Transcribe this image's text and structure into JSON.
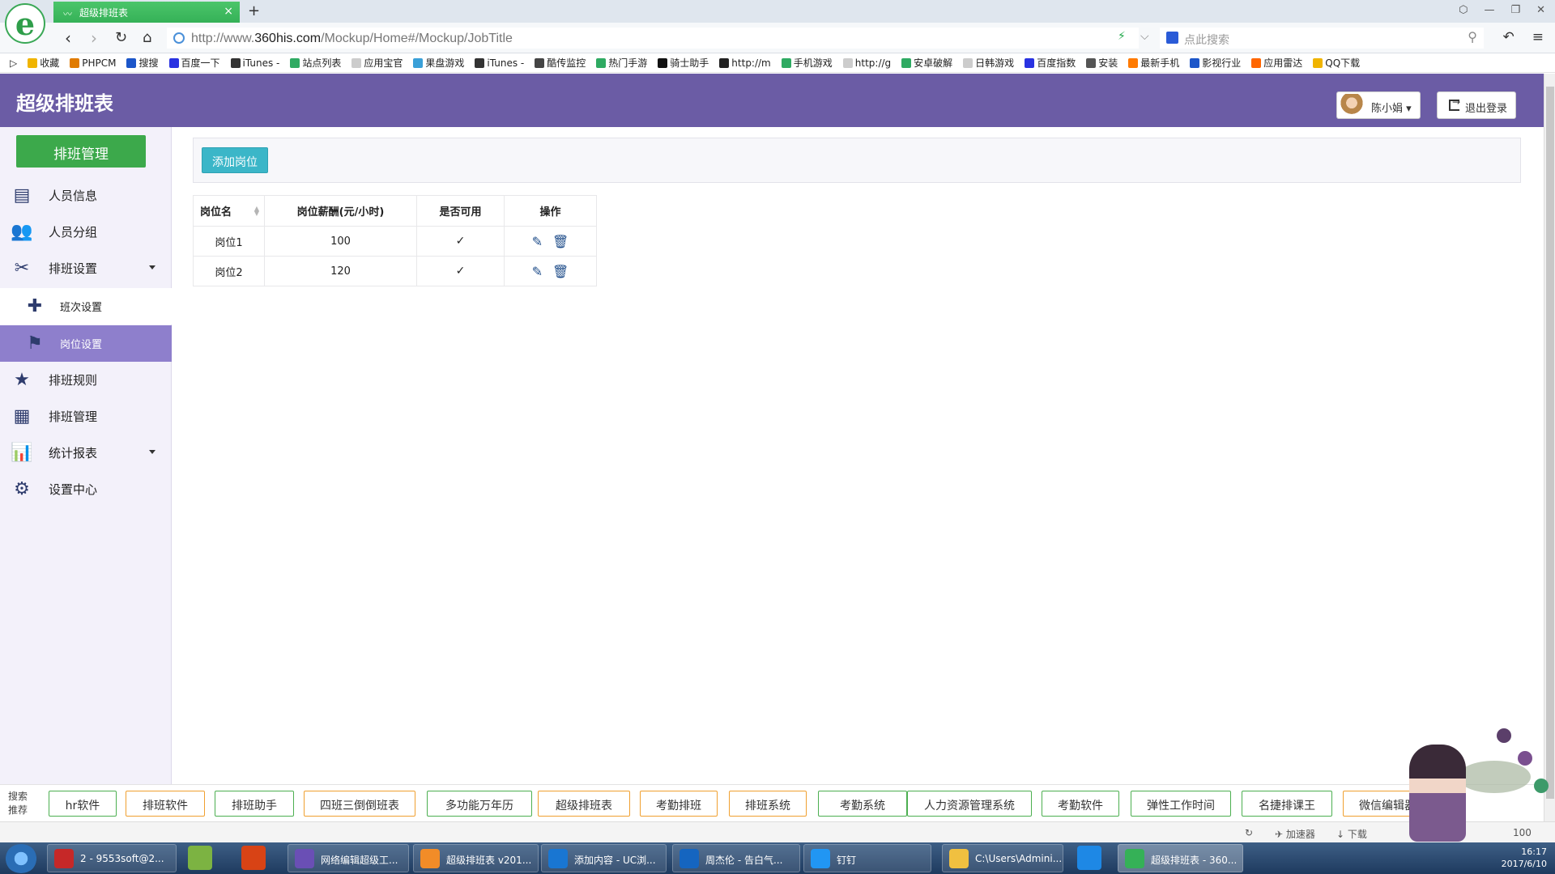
{
  "browser": {
    "tab_title": "超级排班表",
    "url_prefix": "http://www.",
    "url_domain": "360his.com",
    "url_path": "/Mockup/Home#/Mockup/JobTitle",
    "search_placeholder": "点此搜索"
  },
  "bookmarks": [
    {
      "label": "收藏",
      "color": "#f0b400"
    },
    {
      "label": "PHPCM",
      "color": "#e07b00"
    },
    {
      "label": "搜搜",
      "color": "#1c56c9"
    },
    {
      "label": "百度一下",
      "color": "#2932e1"
    },
    {
      "label": "iTunes -",
      "color": "#333333"
    },
    {
      "label": "站点列表",
      "color": "#2faa62"
    },
    {
      "label": "应用宝官",
      "color": "#cccccc"
    },
    {
      "label": "果盘游戏",
      "color": "#3aa0d8"
    },
    {
      "label": "iTunes -",
      "color": "#333333"
    },
    {
      "label": "酷传监控",
      "color": "#444444"
    },
    {
      "label": "热门手游",
      "color": "#2faa62"
    },
    {
      "label": "骑士助手",
      "color": "#111111"
    },
    {
      "label": "http://m",
      "color": "#222222"
    },
    {
      "label": "手机游戏",
      "color": "#2faa62"
    },
    {
      "label": "http://g",
      "color": "#cccccc"
    },
    {
      "label": "安卓破解",
      "color": "#2faa62"
    },
    {
      "label": "日韩游戏",
      "color": "#cccccc"
    },
    {
      "label": "百度指数",
      "color": "#2932e1"
    },
    {
      "label": "安装",
      "color": "#555555"
    },
    {
      "label": "最新手机",
      "color": "#ff7a00"
    },
    {
      "label": "影视行业",
      "color": "#1c56c9"
    },
    {
      "label": "应用雷达",
      "color": "#ff6600"
    },
    {
      "label": "QQ下载",
      "color": "#f0b400"
    }
  ],
  "app": {
    "title": "超级排班表",
    "user_name": "陈小娟",
    "logout_label": "退出登录"
  },
  "sidebar": {
    "main_button": "排班管理",
    "items": [
      {
        "label": "人员信息",
        "icon": "id-card-icon"
      },
      {
        "label": "人员分组",
        "icon": "users-icon"
      },
      {
        "label": "排班设置",
        "icon": "wrench-icon"
      },
      {
        "label": "班次设置",
        "icon": "puzzle-icon"
      },
      {
        "label": "岗位设置",
        "icon": "flag-icon"
      },
      {
        "label": "排班规则",
        "icon": "star-icon"
      },
      {
        "label": "排班管理",
        "icon": "calendar-icon"
      },
      {
        "label": "统计报表",
        "icon": "chart-icon"
      },
      {
        "label": "设置中心",
        "icon": "gear-icon"
      }
    ]
  },
  "toolbar": {
    "add_label": "添加岗位"
  },
  "table": {
    "headers": [
      "岗位名",
      "岗位薪酬(元/小时)",
      "是否可用",
      "操作"
    ],
    "rows": [
      {
        "name": "岗位1",
        "pay": "100",
        "enabled": "✓"
      },
      {
        "name": "岗位2",
        "pay": "120",
        "enabled": "✓"
      }
    ]
  },
  "recommend": {
    "label": "搜索推荐",
    "tags": [
      "hr软件",
      "排班软件",
      "排班助手",
      "四班三倒倒班表",
      "多功能万年历",
      "超级排班表",
      "考勤排班",
      "排班系统",
      "考勤系统",
      "人力资源管理系统",
      "考勤软件",
      "弹性工作时间",
      "名捷排课王",
      "微信编辑器"
    ]
  },
  "statusbar": {
    "accelerator": "加速器",
    "download": "下载",
    "zoom": "100"
  },
  "taskbar": {
    "items": [
      "2 - 9553soft@2...",
      "网络编辑超级工...",
      "超级排班表 v201...",
      "添加内容 - UC浏...",
      "周杰伦 - 告白气...",
      "钉钉",
      "C:\\Users\\Admini...",
      "超级排班表 - 360..."
    ],
    "time": "16:17",
    "date": "2017/6/10"
  },
  "colors": {
    "header": "#6b5ca5",
    "sidebar_active": "#8e7fcc",
    "primary_green": "#3ca94b",
    "add_button": "#3bb6c8"
  }
}
